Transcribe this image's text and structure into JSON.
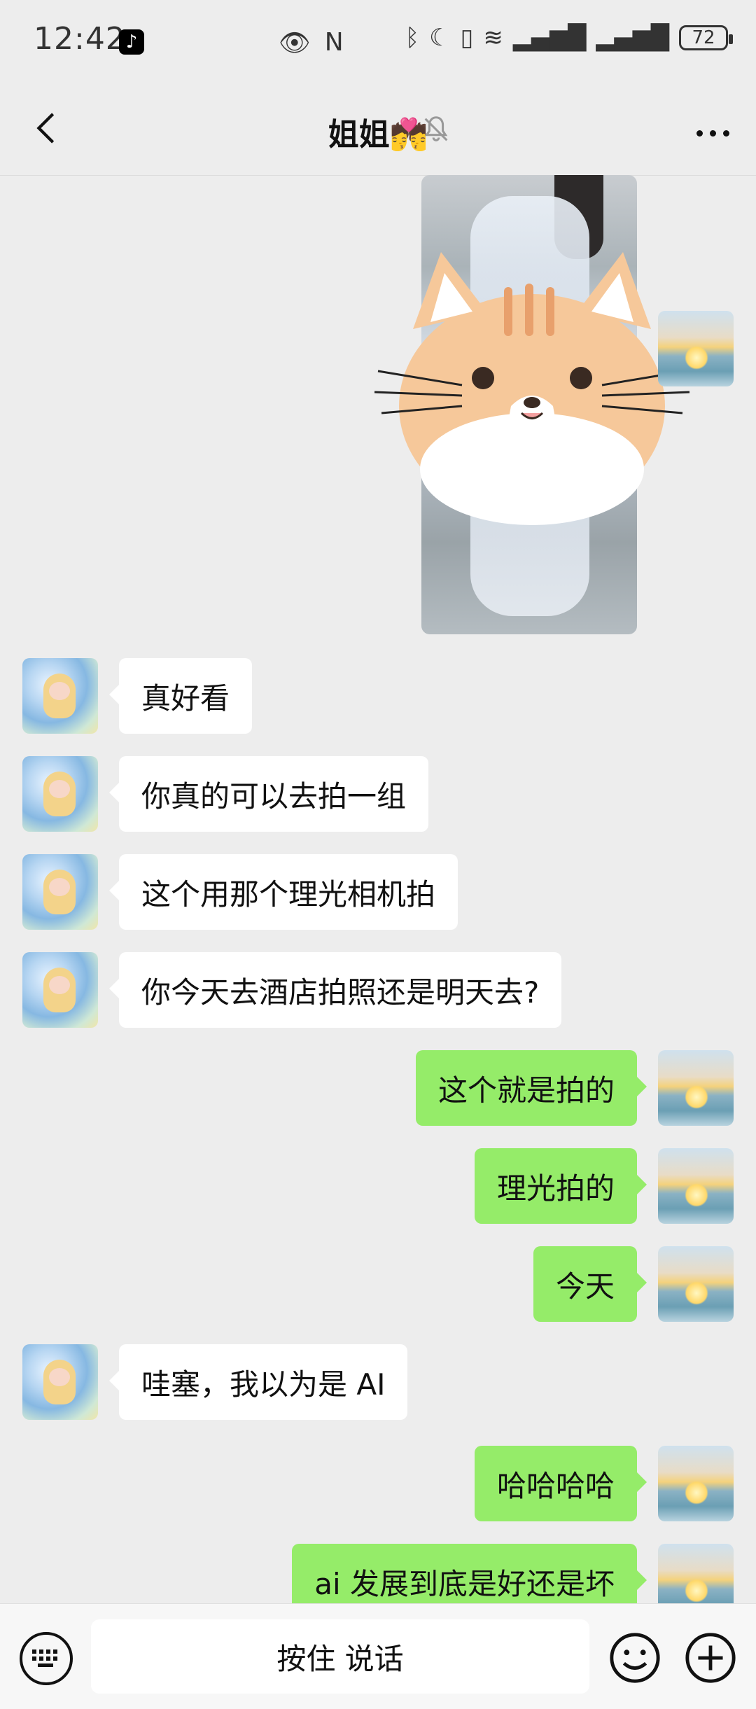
{
  "status": {
    "time": "12:42",
    "battery": "72"
  },
  "header": {
    "title": "姐姐💏"
  },
  "messages": [
    {
      "side": "left",
      "text": "真好看"
    },
    {
      "side": "left",
      "text": "你真的可以去拍一组"
    },
    {
      "side": "left",
      "text": "这个用那个理光相机拍"
    },
    {
      "side": "left",
      "text": "你今天去酒店拍照还是明天去?"
    },
    {
      "side": "right",
      "text": "这个就是拍的"
    },
    {
      "side": "right",
      "text": "理光拍的"
    },
    {
      "side": "right",
      "text": "今天"
    },
    {
      "side": "left",
      "text": "哇塞，我以为是 AI"
    },
    {
      "side": "right",
      "text": "哈哈哈哈"
    },
    {
      "side": "right",
      "text": "ai 发展到底是好还是坏"
    }
  ],
  "input": {
    "hold_to_talk": "按住 说话"
  },
  "icons": {
    "back": "chevron-left-icon",
    "mute": "bell-off-icon",
    "more": "more-icon",
    "keyboard": "keyboard-icon",
    "emoji": "emoji-icon",
    "plus": "plus-icon"
  },
  "colors": {
    "background": "#ededed",
    "bubble_right": "#95ec69",
    "bubble_left": "#ffffff"
  }
}
